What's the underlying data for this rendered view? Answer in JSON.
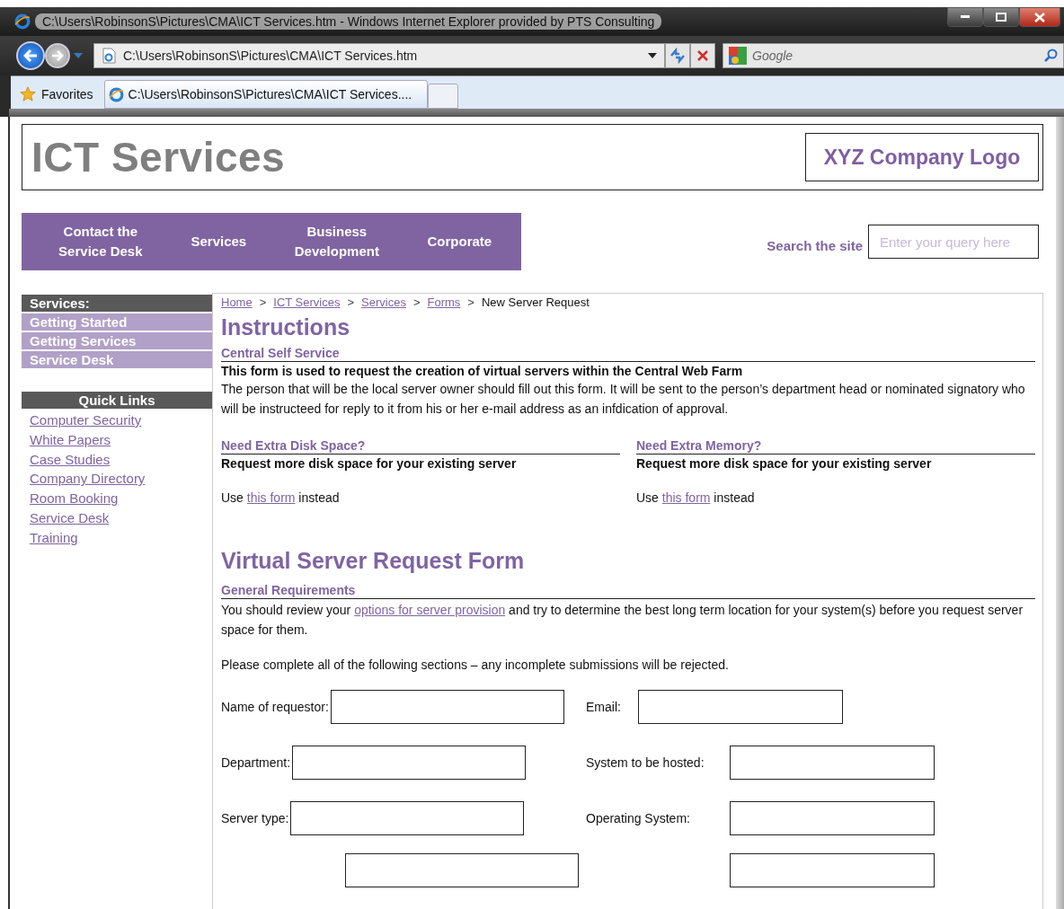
{
  "browser": {
    "title": "C:\\Users\\RobinsonS\\Pictures\\CMA\\ICT Services.htm - Windows Internet Explorer provided by PTS Consulting",
    "address": "C:\\Users\\RobinsonS\\Pictures\\CMA\\ICT Services.htm",
    "search_placeholder": "Google",
    "favorites": "Favorites",
    "tabs": [
      {
        "title": "C:\\Users\\RobinsonS\\Pictures\\CMA\\ICT Services....",
        "selected": true
      }
    ]
  },
  "header": {
    "title": "ICT Services",
    "logo": "XYZ Company Logo"
  },
  "nav": {
    "items": [
      "Contact the Service Desk",
      "Services",
      "Business Development",
      "Corporate"
    ]
  },
  "search": {
    "label": "Search the site",
    "placeholder": "Enter your query here"
  },
  "sidebar": {
    "heading": "Services:",
    "items": [
      "Getting Started",
      "Getting Services",
      "Service Desk"
    ],
    "quick_links_heading": "Quick Links",
    "quick_links": [
      "Computer Security",
      "White Papers",
      "Case Studies",
      "Company Directory",
      "Room Booking",
      "Service Desk",
      "Training"
    ]
  },
  "breadcrumb": {
    "separator": ">",
    "items": [
      {
        "label": "Home",
        "kind": "link"
      },
      {
        "label": "ICT Services",
        "kind": "link"
      },
      {
        "label": "Services",
        "kind": "link"
      },
      {
        "label": "Forms",
        "kind": "link"
      },
      {
        "label": "New Server Request",
        "kind": "current"
      }
    ]
  },
  "instructions": {
    "heading": "Instructions",
    "subheading": "Central Self Service",
    "lead": "This form is used to request the creation of virtual servers within the Central Web Farm",
    "body": "The person that will be the local server owner should fill out this form. It will be sent to the person’s department head or nominated signatory who will be instructeed for reply to it from his or her e-mail address as an infdication of approval."
  },
  "columns": [
    {
      "heading": "Need Extra Disk Space?",
      "lead": "Request more disk space for your existing server",
      "before": "Use",
      "link": "this form",
      "after": "instead"
    },
    {
      "heading": "Need Extra Memory?",
      "lead": "Request more disk space for your existing server",
      "before": "Use",
      "link": "this form",
      "after": "instead"
    }
  ],
  "form": {
    "heading": "Virtual Server Request Form",
    "subheading": "General Requirements",
    "intro_before": "You should review your",
    "intro_link": "options for server provision",
    "intro_after": "and try to determine the best long term location for your system(s) before you request server space for them.",
    "notice": "Please complete all of the following sections – any incomplete submissions will be rejected.",
    "rows": [
      [
        {
          "label": "Name of requestor:"
        },
        {
          "label": "Email:"
        }
      ],
      [
        {
          "label": "Department:"
        },
        {
          "label": "System to be hosted:"
        }
      ],
      [
        {
          "label": "Server type:"
        },
        {
          "label": "Operating System:"
        }
      ],
      [
        {},
        {}
      ]
    ]
  }
}
